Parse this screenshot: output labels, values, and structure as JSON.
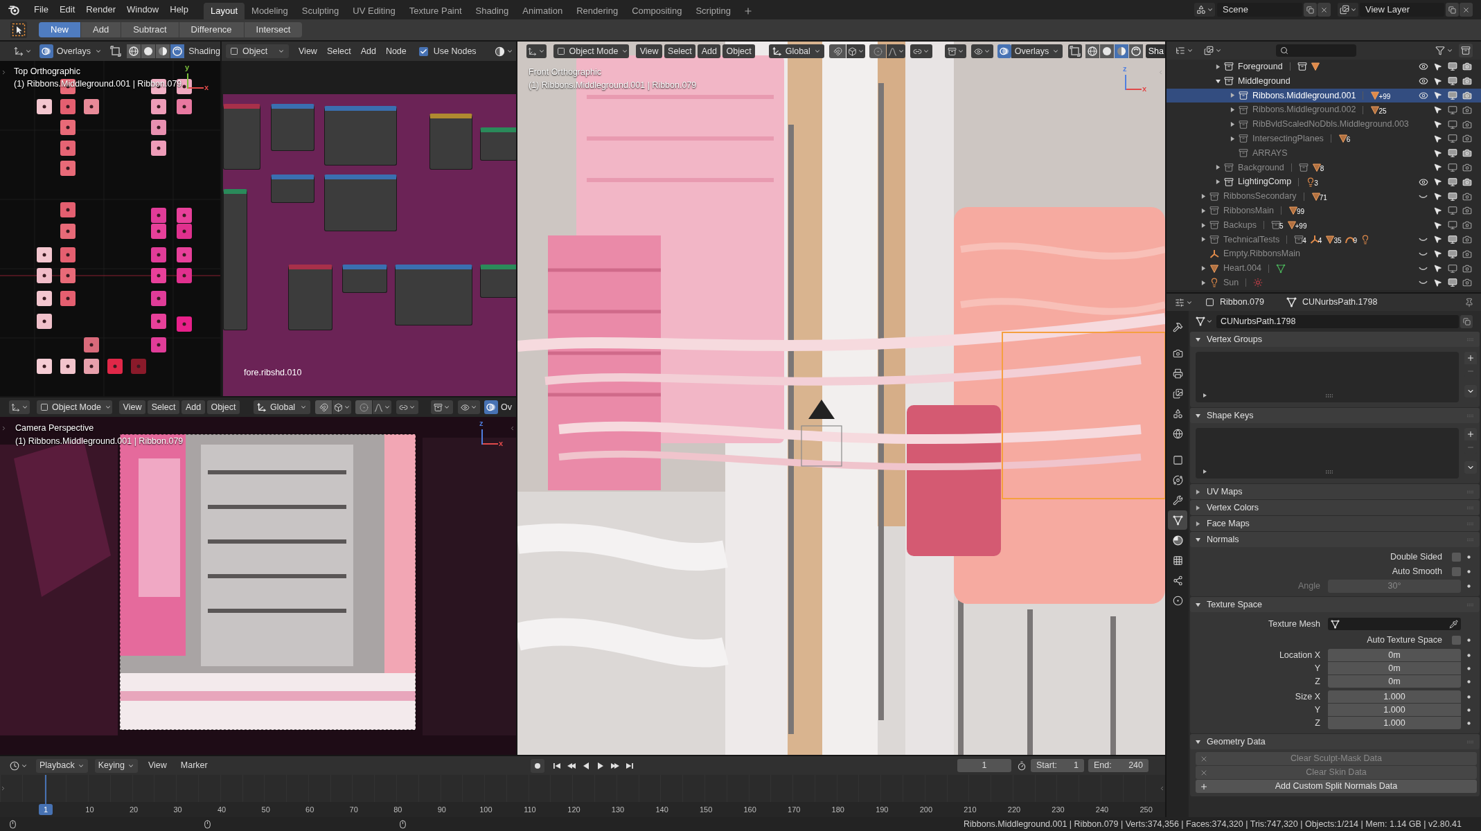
{
  "topbar": {
    "menus": [
      "File",
      "Edit",
      "Render",
      "Window",
      "Help"
    ],
    "workspaces": [
      {
        "label": "Layout",
        "selected": true
      },
      {
        "label": "Modeling",
        "selected": false
      },
      {
        "label": "Sculpting",
        "selected": false
      },
      {
        "label": "UV Editing",
        "selected": false
      },
      {
        "label": "Texture Paint",
        "selected": false
      },
      {
        "label": "Shading",
        "selected": false
      },
      {
        "label": "Animation",
        "selected": false
      },
      {
        "label": "Rendering",
        "selected": false
      },
      {
        "label": "Compositing",
        "selected": false
      },
      {
        "label": "Scripting",
        "selected": false
      }
    ],
    "scene": "Scene",
    "view_layer": "View Layer"
  },
  "tool_header": {
    "modes": [
      {
        "label": "New",
        "selected": true
      },
      {
        "label": "Add",
        "selected": false
      },
      {
        "label": "Subtract",
        "selected": false
      },
      {
        "label": "Difference",
        "selected": false
      },
      {
        "label": "Intersect",
        "selected": false
      }
    ]
  },
  "top_viewport": {
    "overlays": "Overlays",
    "shading_modes": [
      {
        "kind": "wireframe",
        "selected": false
      },
      {
        "kind": "solid",
        "selected": false
      },
      {
        "kind": "material",
        "selected": false
      },
      {
        "kind": "rendered",
        "selected": true
      }
    ],
    "shading_label": "Shading",
    "view_name": "Top Orthographic",
    "object_info": "(1) Ribbons.Middleground.001 | Ribbon.079",
    "gizmo": [
      {
        "label": "y",
        "color": "#7cc03c"
      },
      {
        "label": "x",
        "color": "#e04a4a"
      }
    ]
  },
  "node_editor": {
    "object": "Object",
    "menus": [
      "View",
      "Select",
      "Add",
      "Node"
    ],
    "use_nodes": {
      "label": "Use Nodes",
      "checked": true
    },
    "material": "fore.ribshd.010"
  },
  "camera_viewport": {
    "mode": "Object Mode",
    "menus": [
      "View",
      "Select",
      "Add",
      "Object"
    ],
    "orientation": "Global",
    "overlays": "Ov",
    "view_name": "Camera Perspective",
    "object_info": "(1) Ribbons.Middleground.001 | Ribbon.079",
    "gizmo": [
      {
        "label": "z",
        "color": "#4f7fe0"
      },
      {
        "label": "x",
        "color": "#e04a4a"
      }
    ]
  },
  "front_viewport": {
    "mode": "Object Mode",
    "menus": [
      "View",
      "Select",
      "Add",
      "Object"
    ],
    "orientation": "Global",
    "overlays": "Overlays",
    "shading_modes": [
      {
        "kind": "wireframe",
        "selected": false
      },
      {
        "kind": "solid",
        "selected": false
      },
      {
        "kind": "material",
        "selected": true
      },
      {
        "kind": "rendered",
        "selected": false
      }
    ],
    "shading_label": "Sha",
    "view_name": "Front Orthographic",
    "object_info": "(1) Ribbons.Middleground.001 | Ribbon.079",
    "gizmo": [
      {
        "label": "z",
        "color": "#4f7fe0"
      },
      {
        "label": "x",
        "color": "#e04a4a"
      }
    ]
  },
  "outliner": {
    "rows": [
      {
        "kind": "offscreen_parent",
        "children": [
          {
            "kind": "collection",
            "name": "Foreground",
            "expanded": false,
            "selected": false,
            "excluded": false,
            "hidden": false,
            "viewport": true,
            "render": true,
            "badges": [
              {
                "kind": "collection"
              },
              {
                "kind": "mesh"
              }
            ]
          },
          {
            "kind": "collection",
            "name": "Middleground",
            "expanded": true,
            "selected": false,
            "excluded": false,
            "hidden": false,
            "viewport": true,
            "render": true,
            "children": [
              {
                "kind": "collection",
                "name": "Ribbons.Middleground.001",
                "expanded": false,
                "selected": true,
                "excluded": false,
                "hidden": false,
                "viewport": true,
                "render": true,
                "badges": [
                  {
                    "kind": "mesh",
                    "count": "+99"
                  }
                ]
              },
              {
                "kind": "collection",
                "name": "Ribbons.Middleground.002",
                "expanded": false,
                "selected": false,
                "excluded": true,
                "viewport": false,
                "render": false,
                "badges": [
                  {
                    "kind": "mesh",
                    "count": "25"
                  }
                ]
              },
              {
                "kind": "collection",
                "name": "RibBvldScaledNoDbls.Middleground.003",
                "expanded": false,
                "selected": false,
                "excluded": true,
                "viewport": false,
                "render": false
              },
              {
                "kind": "collection",
                "name": "IntersectingPlanes",
                "expanded": false,
                "selected": false,
                "excluded": true,
                "viewport": false,
                "render": false,
                "badges": [
                  {
                    "kind": "mesh",
                    "count": "6"
                  }
                ]
              },
              {
                "kind": "collection",
                "name": "ARRAYS",
                "selected": false,
                "excluded": true,
                "viewport": true,
                "render": true
              }
            ]
          },
          {
            "kind": "collection",
            "name": "Background",
            "expanded": false,
            "selected": false,
            "excluded": true,
            "viewport": false,
            "render": false,
            "badges": [
              {
                "kind": "collection"
              },
              {
                "kind": "mesh",
                "count": "8"
              }
            ]
          },
          {
            "kind": "collection",
            "name": "LightingComp",
            "expanded": false,
            "selected": false,
            "excluded": false,
            "hidden": false,
            "viewport": true,
            "render": true,
            "badges": [
              {
                "kind": "light",
                "count": "3"
              }
            ]
          }
        ]
      },
      {
        "kind": "collection",
        "name": "RibbonsSecondary",
        "expanded": false,
        "selected": false,
        "excluded": false,
        "hidden": true,
        "viewport": true,
        "render": false,
        "badges": [
          {
            "kind": "mesh",
            "count": "71"
          }
        ]
      },
      {
        "kind": "collection",
        "name": "RibbonsMain",
        "expanded": false,
        "selected": false,
        "excluded": true,
        "viewport": false,
        "render": false,
        "badges": [
          {
            "kind": "mesh",
            "count": "99"
          }
        ]
      },
      {
        "kind": "collection",
        "name": "Backups",
        "expanded": false,
        "selected": false,
        "excluded": true,
        "viewport": false,
        "render": false,
        "badges": [
          {
            "kind": "collection",
            "count": "5"
          },
          {
            "kind": "mesh",
            "count": "+99"
          }
        ]
      },
      {
        "kind": "collection",
        "name": "TechnicalTests",
        "expanded": false,
        "selected": false,
        "excluded": false,
        "hidden": true,
        "viewport": true,
        "render": false,
        "badges": [
          {
            "kind": "collection",
            "count": "4"
          },
          {
            "kind": "empty",
            "count": "4"
          },
          {
            "kind": "mesh",
            "count": "35"
          },
          {
            "kind": "curve",
            "count": "9"
          },
          {
            "kind": "light"
          }
        ]
      },
      {
        "kind": "empty",
        "name": "Empty.RibbonsMain",
        "selected": false,
        "excluded": false,
        "hidden": true,
        "viewport": true,
        "render": false
      },
      {
        "kind": "mesh",
        "name": "Heart.004",
        "expanded": false,
        "selected": false,
        "excluded": false,
        "hidden": true,
        "viewport": false,
        "render": false,
        "badges": [
          {
            "kind": "mesh_data"
          }
        ]
      },
      {
        "kind": "light",
        "name": "Sun",
        "expanded": false,
        "selected": false,
        "excluded": false,
        "hidden": true,
        "viewport": true,
        "render": false,
        "badges": [
          {
            "kind": "sun"
          }
        ]
      }
    ]
  },
  "properties": {
    "object": "Ribbon.079",
    "data": "CUNurbsPath.1798",
    "datablock": "CUNurbsPath.1798",
    "tab_groups": [
      {
        "tabs": [
          {
            "kind": "tool",
            "selected": false
          }
        ]
      },
      {
        "tabs": [
          {
            "kind": "render",
            "selected": false
          },
          {
            "kind": "output",
            "selected": false
          },
          {
            "kind": "view_layer",
            "selected": false
          },
          {
            "kind": "scene",
            "selected": false
          },
          {
            "kind": "world",
            "selected": false
          }
        ]
      },
      {
        "tabs": [
          {
            "kind": "object",
            "selected": false
          },
          {
            "kind": "constraints",
            "selected": false
          },
          {
            "kind": "modifiers",
            "selected": false
          },
          {
            "kind": "data",
            "selected": true
          },
          {
            "kind": "material",
            "selected": false
          },
          {
            "kind": "texture",
            "selected": false
          },
          {
            "kind": "particles",
            "selected": false
          },
          {
            "kind": "physics",
            "selected": false
          }
        ]
      }
    ],
    "panels": [
      {
        "title": "Vertex Groups",
        "expanded": true,
        "rows": [
          {
            "kind": "list"
          }
        ]
      },
      {
        "title": "Shape Keys",
        "expanded": true,
        "rows": [
          {
            "kind": "list"
          }
        ]
      },
      {
        "title": "UV Maps",
        "expanded": false
      },
      {
        "title": "Vertex Colors",
        "expanded": false
      },
      {
        "title": "Face Maps",
        "expanded": false
      },
      {
        "title": "Normals",
        "expanded": true,
        "rows": [
          {
            "kind": "checkbox",
            "label": "Double Sided",
            "checked": false
          },
          {
            "kind": "checkbox",
            "label": "Auto Smooth",
            "checked": false
          },
          {
            "kind": "number",
            "label": "Angle",
            "value": "30°",
            "disabled": true
          }
        ]
      },
      {
        "title": "Texture Space",
        "expanded": true,
        "rows": [
          {
            "kind": "datablock",
            "label": "Texture Mesh"
          },
          {
            "kind": "checkbox",
            "label": "Auto Texture Space",
            "checked": false
          },
          {
            "kind": "vector",
            "fields": [
              {
                "label": "Location X",
                "value": "0m"
              },
              {
                "label": "Y",
                "value": "0m"
              },
              {
                "label": "Z",
                "value": "0m"
              }
            ]
          },
          {
            "kind": "vector",
            "fields": [
              {
                "label": "Size X",
                "value": "1.000"
              },
              {
                "label": "Y",
                "value": "1.000"
              },
              {
                "label": "Z",
                "value": "1.000"
              }
            ]
          }
        ]
      },
      {
        "title": "Geometry Data",
        "expanded": true,
        "rows": [
          {
            "kind": "clear_button",
            "label": "Clear Sculpt-Mask Data",
            "disabled": true
          },
          {
            "kind": "clear_button",
            "label": "Clear Skin Data",
            "disabled": true
          },
          {
            "kind": "add_button",
            "label": "Add Custom Split Normals Data",
            "disabled": false
          }
        ]
      }
    ]
  },
  "timeline": {
    "menus": [
      {
        "label": "Playback",
        "dropdown": true
      },
      {
        "label": "Keying",
        "dropdown": true
      },
      {
        "label": "View",
        "dropdown": false
      },
      {
        "label": "Marker",
        "dropdown": false
      }
    ],
    "frame": "1",
    "start_label": "Start:",
    "start": "1",
    "end_label": "End:",
    "end": "240",
    "marker": "1",
    "ticks": [
      "10",
      "20",
      "30",
      "40",
      "50",
      "60",
      "70",
      "80",
      "90",
      "100",
      "110",
      "120",
      "130",
      "140",
      "150",
      "160",
      "170",
      "180",
      "190",
      "200",
      "210",
      "220",
      "230",
      "240",
      "250"
    ]
  },
  "status_bar": {
    "info": "Ribbons.Middleground.001 | Ribbon.079 | Verts:374,356 | Faces:374,320 | Tris:747,320 | Objects:1/214 | Mem: 1.14 GB | v2.80.41"
  }
}
